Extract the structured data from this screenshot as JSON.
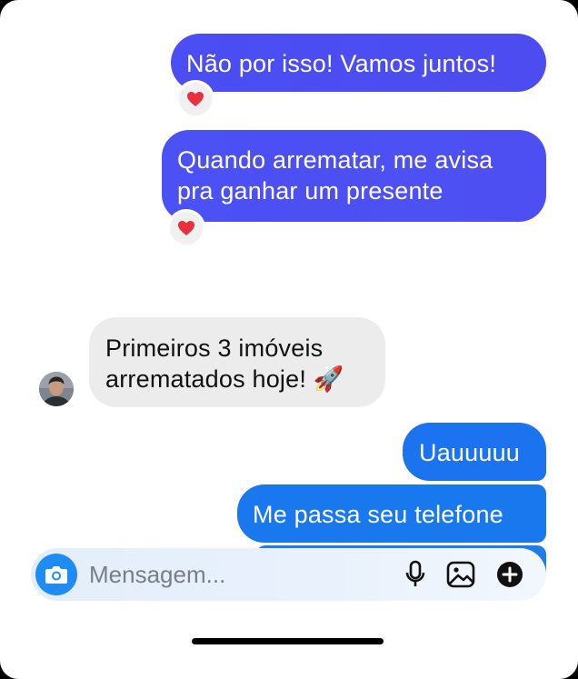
{
  "messages": [
    {
      "id": "b1",
      "direction": "outgoing",
      "text": "Não por isso! Vamos juntos!",
      "reaction": "❤️"
    },
    {
      "id": "b2",
      "direction": "outgoing",
      "lines": [
        "Quando arrematar, me avisa",
        "pra ganhar um presente"
      ],
      "reaction": "❤️"
    },
    {
      "id": "b3",
      "direction": "incoming",
      "lines": [
        "Primeiros 3 imóveis",
        "arrematados hoje! 🚀"
      ]
    },
    {
      "id": "b4",
      "direction": "outgoing",
      "text": "Uauuuuu"
    },
    {
      "id": "b5",
      "direction": "outgoing",
      "text": "Me passa seu telefone"
    }
  ],
  "composer": {
    "placeholder": "Mensagem...",
    "icons": [
      "camera-icon",
      "microphone-icon",
      "gallery-icon",
      "plus-icon"
    ]
  },
  "colors": {
    "outgoing_purple": "#4a4ef3",
    "outgoing_blue": "#1b73ef",
    "incoming_gray": "#ececec",
    "camera_blue": "#1f8cf5"
  }
}
